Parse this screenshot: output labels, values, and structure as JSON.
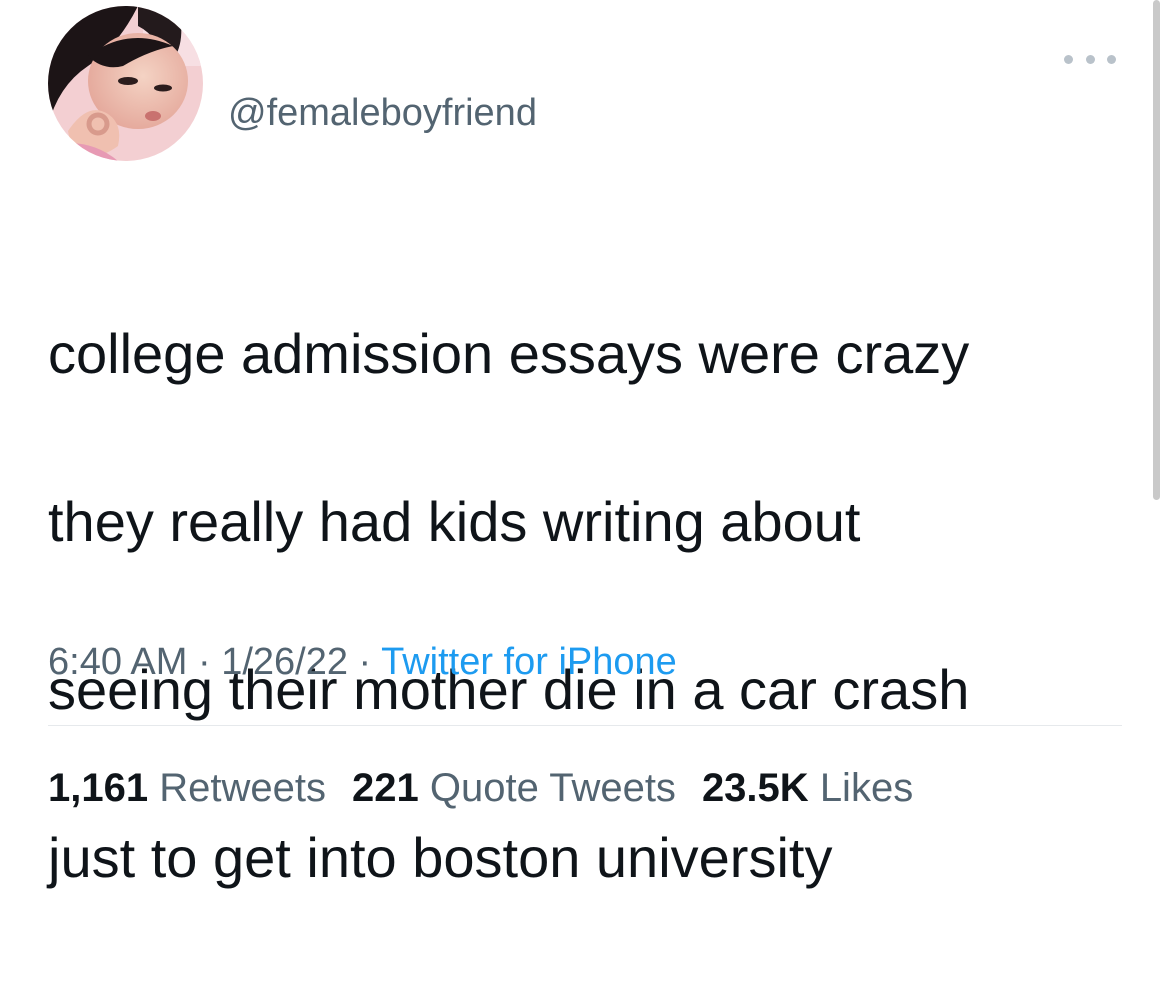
{
  "tweet": {
    "handle": "@femaleboyfriend",
    "text_lines": [
      "college admission essays were crazy",
      "they really had kids writing about",
      "seeing their mother die in a car crash",
      "just to get into boston university"
    ],
    "time": "6:40 AM",
    "separator": " · ",
    "date": "1/26/22",
    "source": "Twitter for iPhone"
  },
  "stats": {
    "retweets": {
      "count": "1,161",
      "label": "Retweets"
    },
    "quote_tweets": {
      "count": "221",
      "label": "Quote Tweets"
    },
    "likes": {
      "count": "23.5K",
      "label": "Likes"
    }
  },
  "icons": {
    "avatar": "avatar",
    "more": "more-options-icon"
  },
  "colors": {
    "text": "#0f1419",
    "secondary": "#536471",
    "link": "#1d9bf0",
    "divider": "#e6e9ec"
  }
}
